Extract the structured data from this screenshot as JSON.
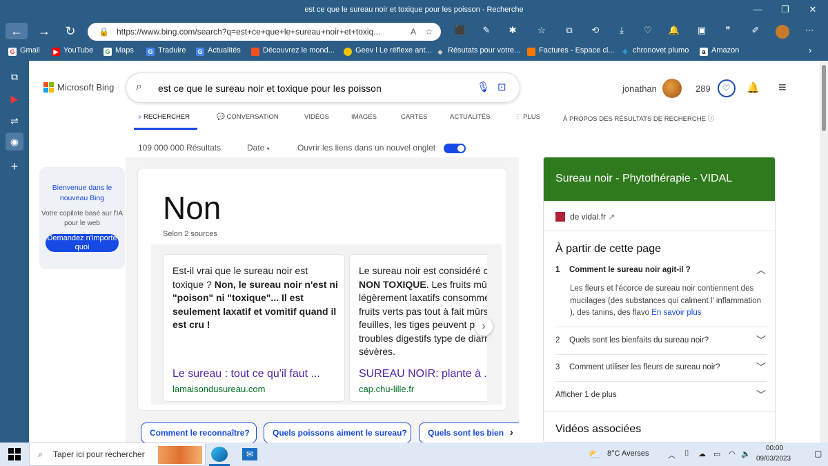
{
  "window": {
    "title": "est ce que le sureau noir et toxique pour les poisson - Recherche"
  },
  "browser": {
    "url": "https://www.bing.com/search?q=est+ce+que+le+sureau+noir+et+toxiq..."
  },
  "bookmarks": [
    {
      "label": "Gmail",
      "icon": "G",
      "color": "#ea4335"
    },
    {
      "label": "YouTube",
      "icon": "▶",
      "color": "#ff0000"
    },
    {
      "label": "Maps",
      "icon": "G",
      "color": "#34a853"
    },
    {
      "label": "Traduire",
      "icon": "G",
      "color": "#4285f4"
    },
    {
      "label": "Actualités",
      "icon": "G",
      "color": "#4285f4"
    },
    {
      "label": "Découvrez le mond...",
      "icon": "■",
      "color": "#f25022"
    },
    {
      "label": "Geev l Le réflexe ant...",
      "icon": "●",
      "color": "#f5c400"
    },
    {
      "label": "Résutats pour votre...",
      "icon": "◆",
      "color": "#cccccc"
    },
    {
      "label": "Factures - Espace cl...",
      "icon": "■",
      "color": "#ff7900"
    },
    {
      "label": "chronovet plumo",
      "icon": "✚",
      "color": "#2a9fd8"
    },
    {
      "label": "Amazon",
      "icon": "a",
      "color": "#ffffff"
    }
  ],
  "bing": {
    "logo": "Microsoft Bing",
    "query": "est ce que le sureau noir et toxique pour les poisson",
    "user": "jonathan",
    "points": "289",
    "tabs": [
      "RECHERCHER",
      "CONVERSATION",
      "VIDÉOS",
      "IMAGES",
      "CARTES",
      "ACTUALITÉS",
      "PLUS",
      "À PROPOS DES RÉSULTATS DE RECHERCHE"
    ],
    "results_count": "109 000 000 Résultats",
    "date_filter": "Date",
    "new_tab_label": "Ouvrir les liens dans un nouvel onglet"
  },
  "welcome": {
    "title": "Bienvenue dans le nouveau Bing",
    "desc": "Votre copilote basé sur l'IA pour le web",
    "button": "Demandez n'importe quoi"
  },
  "answer": {
    "big": "Non",
    "sources": "Selon 2 sources",
    "cards": [
      {
        "pre": "Est-il vrai que le sureau noir est toxique ? ",
        "bold": "Non, le sureau noir n'est ni \"poison\" ni \"toxique\"... Il est seulement laxatif et vomitif quand il est cru !",
        "post": "",
        "title": "Le sureau : tout ce qu'il faut ...",
        "domain": "lamaisondusureau.com"
      },
      {
        "pre": "Le sureau noir est considéré comme ",
        "bold": "NON TOXIQUE",
        "post": ". Les fruits mûrs sont légèrement laxatifs consommés crus. Les fruits verts pas tout à fait mûrs, les feuilles, les tiges peuvent provoquer des troubles digestifs type de diarrhées sévères.",
        "title": "SUREAU NOIR: plante à ...",
        "domain": "cap.chu-lille.fr"
      }
    ]
  },
  "suggestions": [
    "Comment le reconnaître?",
    "Quels poissons aiment le sureau?",
    "Quels sont les bien"
  ],
  "panel": {
    "title": "Sureau noir - Phytothérapie - VIDAL",
    "source": "de vidal.fr",
    "from_page": "À partir de cette page",
    "faqs": [
      {
        "n": "1",
        "q": "Comment le sureau noir agit-il ?"
      },
      {
        "n": "2",
        "q": "Quels sont les bienfaits du sureau noir?"
      },
      {
        "n": "3",
        "q": "Comment utiliser les fleurs de sureau noir?"
      }
    ],
    "faq1_answer": "Les fleurs et l'écorce de sureau noir contiennent des mucilages (des substances qui calment l' inflammation ), des tanins, des flavo",
    "learn_more": "En savoir plus",
    "show_more": "Afficher 1 de plus",
    "videos": "Vidéos associées"
  },
  "taskbar": {
    "search": "Taper ici pour rechercher",
    "weather": "8°C  Averses",
    "time": "00:00",
    "date": "09/03/2023"
  }
}
